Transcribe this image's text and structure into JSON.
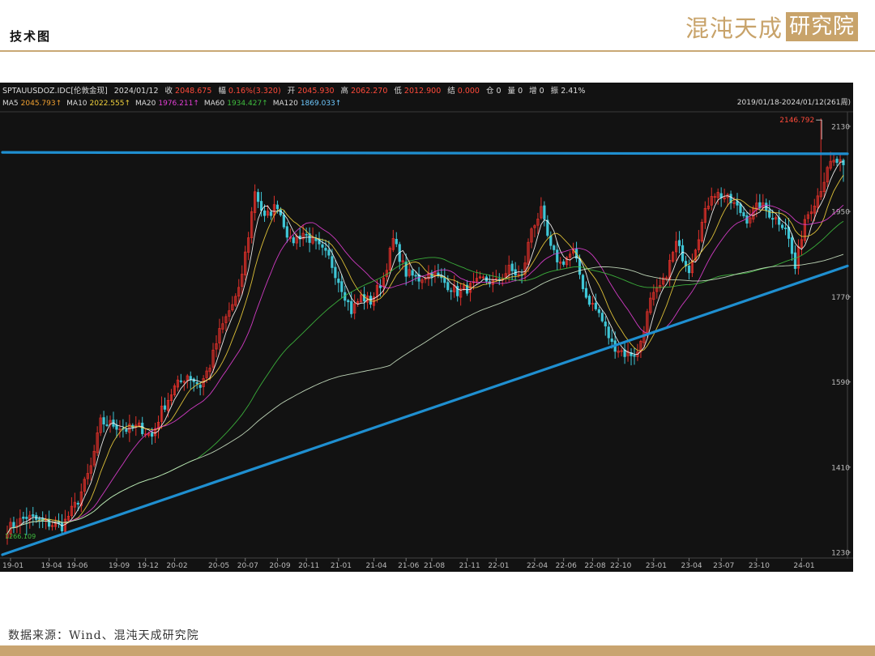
{
  "page": {
    "title": "技术图",
    "logo_text": "混沌天成",
    "logo_boxed": "研究院",
    "source": "数据来源：Wind、混沌天成研究院"
  },
  "colors": {
    "background": "#121212",
    "up_candle": "#e0302a",
    "down_candle": "#3fc6d6",
    "ma5": "#ffffff",
    "ma10": "#f2d23c",
    "ma20": "#e43fd6",
    "ma60": "#3fbf3f",
    "ma120": "#cfe8c8",
    "trendline": "#1f8fd0",
    "accent": "#c8a36a"
  },
  "header": {
    "row1": [
      {
        "text": "SPTAUUSDOZ.IDC[伦敦金现]",
        "color": "#dcdcdc"
      },
      {
        "text": "2024/01/12",
        "color": "#dcdcdc"
      },
      {
        "text": "收",
        "color": "#dcdcdc"
      },
      {
        "text": "2048.675",
        "color": "#ff4a3a"
      },
      {
        "text": "幅",
        "color": "#dcdcdc"
      },
      {
        "text": "0.16%(3.320)",
        "color": "#ff4a3a"
      },
      {
        "text": "开",
        "color": "#dcdcdc"
      },
      {
        "text": "2045.930",
        "color": "#ff4a3a"
      },
      {
        "text": "高",
        "color": "#dcdcdc"
      },
      {
        "text": "2062.270",
        "color": "#ff4a3a"
      },
      {
        "text": "低",
        "color": "#dcdcdc"
      },
      {
        "text": "2012.900",
        "color": "#ff4a3a"
      },
      {
        "text": "结",
        "color": "#dcdcdc"
      },
      {
        "text": "0.000",
        "color": "#ff4a3a"
      },
      {
        "text": "仓",
        "color": "#dcdcdc"
      },
      {
        "text": "0",
        "color": "#dcdcdc"
      },
      {
        "text": "量",
        "color": "#dcdcdc"
      },
      {
        "text": "0",
        "color": "#dcdcdc"
      },
      {
        "text": "增",
        "color": "#dcdcdc"
      },
      {
        "text": "0",
        "color": "#dcdcdc"
      },
      {
        "text": "振",
        "color": "#dcdcdc"
      },
      {
        "text": "2.41%",
        "color": "#dcdcdc"
      }
    ],
    "row2": [
      {
        "text": "MA5",
        "color": "#dcdcdc"
      },
      {
        "text": "2045.793↑",
        "color": "#f0a030"
      },
      {
        "text": "MA10",
        "color": "#dcdcdc"
      },
      {
        "text": "2022.555↑",
        "color": "#f2d23c"
      },
      {
        "text": "MA20",
        "color": "#dcdcdc"
      },
      {
        "text": "1976.211↑",
        "color": "#e43fd6"
      },
      {
        "text": "MA60",
        "color": "#dcdcdc"
      },
      {
        "text": "1934.427↑",
        "color": "#3fbf3f"
      },
      {
        "text": "MA120",
        "color": "#dcdcdc"
      },
      {
        "text": "1869.033↑",
        "color": "#6ec9ff"
      }
    ],
    "range": "2019/01/18-2024/01/12(261周)"
  },
  "chart_data": {
    "type": "candlestick",
    "title": "SPTAUUSDOZ.IDC[伦敦金现]",
    "frequency": "weekly",
    "period": "2019/01/18-2024/01/12",
    "y_ticks": [
      2130,
      1950,
      1770,
      1590,
      1410,
      1230
    ],
    "ylim": [
      1220,
      2150
    ],
    "x_tick_labels": [
      "19-01",
      "19-04",
      "19-06",
      "19-09",
      "19-12",
      "20-02",
      "20-05",
      "20-07",
      "20-09",
      "20-11",
      "21-01",
      "21-04",
      "21-06",
      "21-08",
      "21-11",
      "22-01",
      "22-04",
      "22-06",
      "22-08",
      "22-10",
      "23-01",
      "23-04",
      "23-07",
      "23-10",
      "24-01"
    ],
    "annotations": [
      {
        "text": "2146.792",
        "value": 2146.792,
        "note": "period high"
      },
      {
        "text": "1266.109",
        "value": 1266.109,
        "note": "period low"
      }
    ],
    "path_anchors": [
      [
        0,
        1280
      ],
      [
        6,
        1305
      ],
      [
        12,
        1292
      ],
      [
        17,
        1285
      ],
      [
        22,
        1340
      ],
      [
        26,
        1410
      ],
      [
        29,
        1505
      ],
      [
        33,
        1500
      ],
      [
        37,
        1490
      ],
      [
        41,
        1495
      ],
      [
        45,
        1475
      ],
      [
        48,
        1530
      ],
      [
        52,
        1578
      ],
      [
        56,
        1605
      ],
      [
        60,
        1582
      ],
      [
        63,
        1625
      ],
      [
        66,
        1695
      ],
      [
        69,
        1740
      ],
      [
        72,
        1780
      ],
      [
        75,
        1900
      ],
      [
        77,
        1995
      ],
      [
        80,
        1935
      ],
      [
        84,
        1965
      ],
      [
        88,
        1885
      ],
      [
        92,
        1905
      ],
      [
        96,
        1880
      ],
      [
        100,
        1852
      ],
      [
        104,
        1790
      ],
      [
        107,
        1740
      ],
      [
        110,
        1770
      ],
      [
        113,
        1760
      ],
      [
        117,
        1810
      ],
      [
        120,
        1890
      ],
      [
        124,
        1820
      ],
      [
        128,
        1808
      ],
      [
        132,
        1822
      ],
      [
        136,
        1800
      ],
      [
        140,
        1780
      ],
      [
        144,
        1790
      ],
      [
        148,
        1806
      ],
      [
        152,
        1800
      ],
      [
        156,
        1828
      ],
      [
        160,
        1810
      ],
      [
        163,
        1915
      ],
      [
        166,
        1950
      ],
      [
        169,
        1870
      ],
      [
        172,
        1840
      ],
      [
        176,
        1865
      ],
      [
        180,
        1770
      ],
      [
        184,
        1735
      ],
      [
        188,
        1670
      ],
      [
        192,
        1650
      ],
      [
        196,
        1650
      ],
      [
        200,
        1760
      ],
      [
        204,
        1800
      ],
      [
        208,
        1882
      ],
      [
        212,
        1830
      ],
      [
        216,
        1925
      ],
      [
        219,
        1990
      ],
      [
        222,
        1985
      ],
      [
        226,
        1965
      ],
      [
        230,
        1935
      ],
      [
        234,
        1965
      ],
      [
        238,
        1940
      ],
      [
        242,
        1920
      ],
      [
        245,
        1830
      ],
      [
        248,
        1935
      ],
      [
        252,
        1985
      ],
      [
        256,
        2050
      ],
      [
        258,
        2055
      ],
      [
        260,
        2049
      ]
    ],
    "series": [
      {
        "name": "MA5",
        "value_last": 2045.793
      },
      {
        "name": "MA10",
        "value_last": 2022.555
      },
      {
        "name": "MA20",
        "value_last": 1976.211
      },
      {
        "name": "MA60",
        "value_last": 1934.427
      },
      {
        "name": "MA120",
        "value_last": 1869.033
      }
    ],
    "trendlines": [
      {
        "type": "horizontal-resistance",
        "from": [
          0,
          2075
        ],
        "to": [
          261,
          2072
        ]
      },
      {
        "type": "ascending-support",
        "from": [
          0,
          1225
        ],
        "to": [
          261,
          1835
        ]
      }
    ],
    "last_bar": {
      "date": "2024/01/12",
      "open": 2045.93,
      "high": 2062.27,
      "low": 2012.9,
      "close": 2048.675,
      "change_pct": 0.16,
      "change": 3.32
    }
  }
}
